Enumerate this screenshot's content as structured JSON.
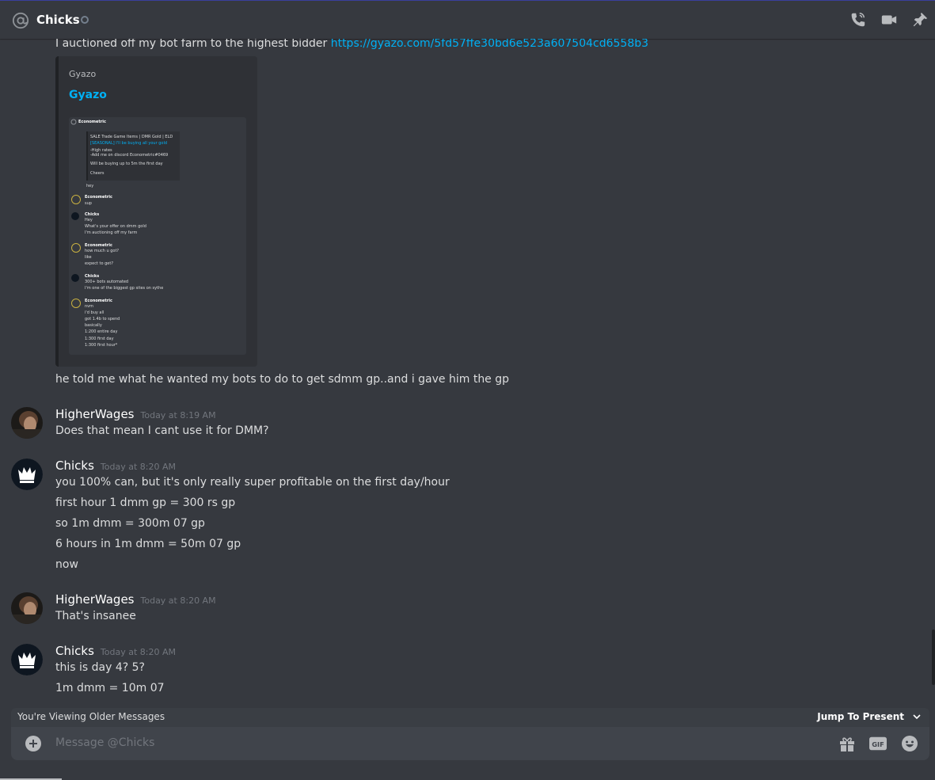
{
  "header": {
    "title": "Chicks"
  },
  "embed": {
    "intro_text": "I auctioned off my bot farm to the highest bidder",
    "link": "https://gyazo.com/5fd57ffe30bd6e523a607504cd6558b3",
    "provider": "Gyazo",
    "title": "Gyazo",
    "thumbnail_lines": [
      "Econometric",
      "SALE Trade Game Items | DMR Gold | ELD",
      "[SEASONAL] I'll be buying all your gold",
      "-High rates",
      "-Add me on discord Econometric#0469",
      "Will be buying up to 5m the first day",
      "Cheers",
      "hey",
      "Econometric",
      "sup",
      "Chicks",
      "Hey",
      "What's your offer on dmm gold",
      "I'm auctioning off my farm",
      "Econometric",
      "how much u got?",
      "like",
      "expect to get?",
      "Chicks",
      "300+ bots automated",
      "I'm one of the biggest gp sites on sythe",
      "Econometric",
      "nvm",
      "i'd buy all",
      "got 1.4b to spend",
      "basically",
      "1:200 entire day",
      "1:300 first day",
      "1:300 first hour*"
    ]
  },
  "messages": [
    {
      "text": "he told me what he wanted my bots to do to get sdmm gp..and  i gave him the gp"
    },
    {
      "author": "HigherWages",
      "timestamp": "Today at 8:19 AM",
      "lines": [
        "Does that mean I cant use it for DMM?"
      ]
    },
    {
      "author": "Chicks",
      "timestamp": "Today at 8:20 AM",
      "lines": [
        "you 100% can, but it's only really super profitable on the first day/hour",
        "first hour 1 dmm gp = 300 rs gp",
        "so 1m dmm = 300m 07 gp",
        "6 hours in 1m dmm = 50m 07 gp",
        "now"
      ]
    },
    {
      "author": "HigherWages",
      "timestamp": "Today at 8:20 AM",
      "lines": [
        "That's insanee"
      ]
    },
    {
      "author": "Chicks",
      "timestamp": "Today at 8:20 AM",
      "lines": [
        "this is day 4? 5?",
        "1m dmm = 10m 07"
      ]
    }
  ],
  "banner": {
    "older": "You're Viewing Older Messages",
    "jump": "Jump To Present"
  },
  "composer": {
    "placeholder": "Message @Chicks"
  },
  "icons": {
    "at": "at-icon",
    "status": "offline-status-icon",
    "call": "call-icon",
    "video": "video-icon",
    "pin": "pin-icon",
    "plus": "upload-plus-icon",
    "gift": "gift-icon",
    "gif": "gif-icon",
    "emoji": "emoji-icon"
  },
  "colors": {
    "background": "#36393f",
    "link": "#00b0f4",
    "composer": "#40444b"
  }
}
